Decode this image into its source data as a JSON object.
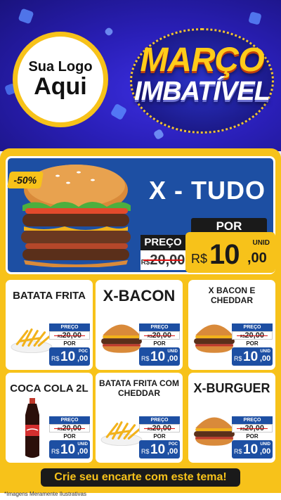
{
  "header": {
    "logo_line1": "Sua Logo",
    "logo_line2": "Aqui",
    "title_line1": "MARÇO",
    "title_line2": "IMBATÍVEL"
  },
  "featured": {
    "discount_badge": "-50%",
    "name": "X - TUDO",
    "preco_label": "PREÇO",
    "old_currency": "R$",
    "old_price": "20,00",
    "por_label": "POR",
    "currency": "R$",
    "price_int": "10",
    "price_dec": ",00",
    "unit": "UNID"
  },
  "products": [
    {
      "name": "BATATA FRITA",
      "preco_label": "PREÇO",
      "old_currency": "R$",
      "old_price": "20,00",
      "por_label": "POR",
      "currency": "R$",
      "price_int": "10",
      "price_dec": ",00",
      "unit": "POC",
      "icon": "fries-icon"
    },
    {
      "name": "X-BACON",
      "preco_label": "PREÇO",
      "old_currency": "R$",
      "old_price": "20,00",
      "por_label": "POR",
      "currency": "R$",
      "price_int": "10",
      "price_dec": ",00",
      "unit": "UNID",
      "icon": "burger-icon"
    },
    {
      "name": "X BACON E CHEDDAR",
      "preco_label": "PREÇO",
      "old_currency": "R$",
      "old_price": "20,00",
      "por_label": "POR",
      "currency": "R$",
      "price_int": "10",
      "price_dec": ",00",
      "unit": "UNID",
      "icon": "burger-icon"
    },
    {
      "name": "COCA COLA 2L",
      "preco_label": "PREÇO",
      "old_currency": "R$",
      "old_price": "20,00",
      "por_label": "POR",
      "currency": "R$",
      "price_int": "10",
      "price_dec": ",00",
      "unit": "UNID",
      "icon": "bottle-icon"
    },
    {
      "name": "BATATA FRITA COM CHEDDAR",
      "preco_label": "PREÇO",
      "old_currency": "R$",
      "old_price": "20,00",
      "por_label": "POR",
      "currency": "R$",
      "price_int": "10",
      "price_dec": ",00",
      "unit": "POC",
      "icon": "fries-icon"
    },
    {
      "name": "X-BURGUER",
      "preco_label": "PREÇO",
      "old_currency": "R$",
      "old_price": "20,00",
      "por_label": "POR",
      "currency": "R$",
      "price_int": "10",
      "price_dec": ",00",
      "unit": "UNID",
      "icon": "burger-icon"
    }
  ],
  "cta": "Crie seu encarte com este tema!",
  "disclaimer": "*Imagens Meramente Ilustrativas",
  "colors": {
    "accent": "#f7c21a",
    "brand_blue": "#1d4fa3",
    "background": "#2a1fb8"
  }
}
